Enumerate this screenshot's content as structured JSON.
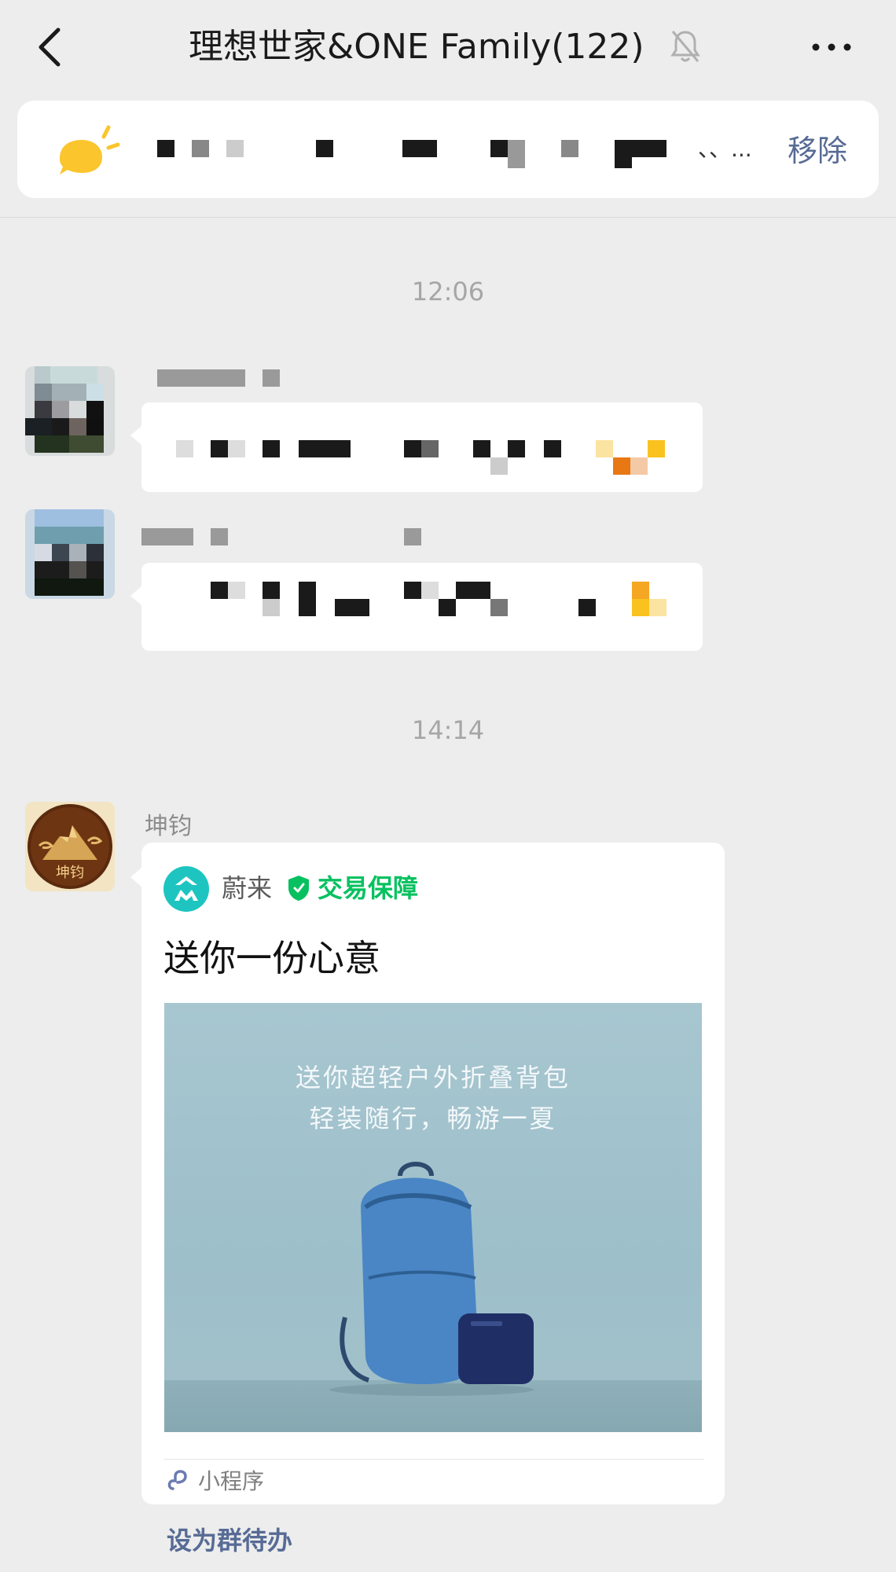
{
  "header": {
    "title": "理想世家&ONE Family(122)",
    "back_icon": "chevron-left-icon",
    "mute_icon": "bell-off-icon",
    "more_icon": "more-dots-icon"
  },
  "notice": {
    "icon": "announcement-bubble-icon",
    "text_suffix": "、、...",
    "remove_label": "移除"
  },
  "messages": [
    {
      "time": "12:06",
      "sender_redacted": true,
      "text_redacted": true
    },
    {
      "sender_redacted": true,
      "text_redacted": true
    },
    {
      "time": "14:14",
      "sender": "坤钧"
    }
  ],
  "avatar_text": "坤钧",
  "card": {
    "brand": "蔚来",
    "badge": "交易保障",
    "title": "送你一份心意",
    "banner_line1": "送你超轻户外折叠背包",
    "banner_line2": "轻装随行，畅游一夏",
    "footer_label": "小程序",
    "footer_icon": "mini-program-link-icon"
  },
  "todo_label": "设为群待办",
  "colors": {
    "background": "#ededed",
    "link_blue": "#576b95",
    "green": "#07c160",
    "bell_yellow": "#fbc52d"
  }
}
